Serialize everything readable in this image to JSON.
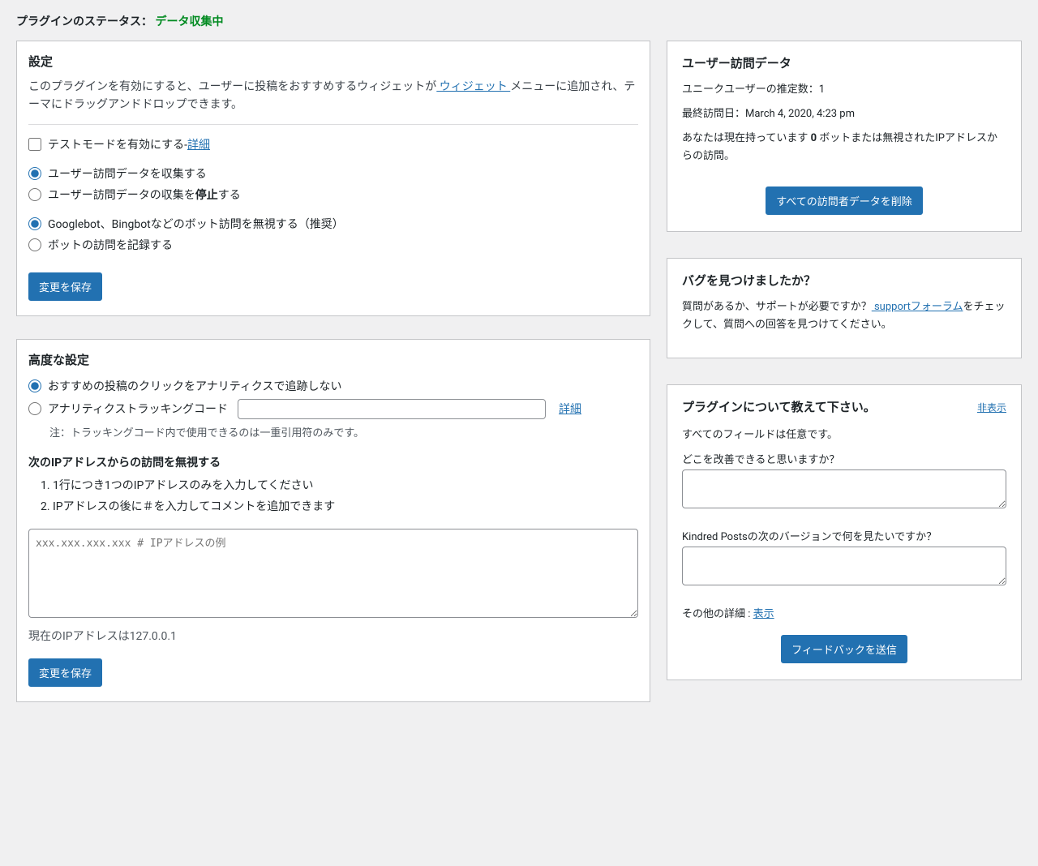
{
  "status": {
    "label": "プラグインのステータス：",
    "value": "データ収集中"
  },
  "settings": {
    "title": "設定",
    "desc_a": "このプラグインを有効にすると、ユーザーに投稿をおすすめするウィジェットが",
    "widget_link": " ウィジェット ",
    "desc_b": "メニューに追加され、テーマにドラッグアンドドロップできます。",
    "test_mode": "テストモードを有効にする-",
    "detail": "詳細",
    "collect_on": "ユーザー訪問データを収集する",
    "collect_off_a": "ユーザー訪問データの収集を",
    "collect_off_b": "停止",
    "collect_off_c": "する",
    "botignore_on": "Googlebot、Bingbotなどのボット訪問を無視する（推奨）",
    "botignore_off": "ボットの訪問を記録する",
    "save": "変更を保存"
  },
  "advanced": {
    "title": "高度な設定",
    "track_off": "おすすめの投稿のクリックをアナリティクスで追跡しない",
    "track_on": "アナリティクストラッキングコード",
    "detail": "詳細",
    "track_note": "注：トラッキングコード内で使用できるのは一重引用符のみです。",
    "ignore_h": "次のIPアドレスからの訪問を無視する",
    "ip_note1": "1行につき1つのIPアドレスのみを入力してください",
    "ip_note2": "IPアドレスの後に＃を入力してコメントを追加できます",
    "ip_placeholder": "xxx.xxx.xxx.xxx # IPアドレスの例",
    "current_ip": "現在のIPアドレスは127.0.0.1",
    "save": "変更を保存"
  },
  "visitdata": {
    "title": "ユーザー訪問データ",
    "unique": "ユニークユーザーの推定数：1",
    "last": "最終訪問日：March 4, 2020, 4:23 pm",
    "have_a": "あなたは現在持っています ",
    "have_n": "0",
    "have_b": " ボットまたは無視されたIPアドレスからの訪問。",
    "delete": "すべての訪問者データを削除"
  },
  "bug": {
    "title": "バグを見つけましたか？",
    "text_a": "質問があるか、サポートが必要ですか？",
    "forum_link": " supportフォーラム",
    "text_b": "をチェックして、質問への回答を見つけてください。"
  },
  "feedback": {
    "title": "プラグインについて教えて下さい。",
    "hide": "非表示",
    "optional": "すべてのフィールドは任意です。",
    "q1": "どこを改善できると思いますか？",
    "q2": "Kindred Postsの次のバージョンで何を見たいですか？",
    "more_a": "その他の詳細 : ",
    "more_link": "表示",
    "send": "フィードバックを送信"
  }
}
